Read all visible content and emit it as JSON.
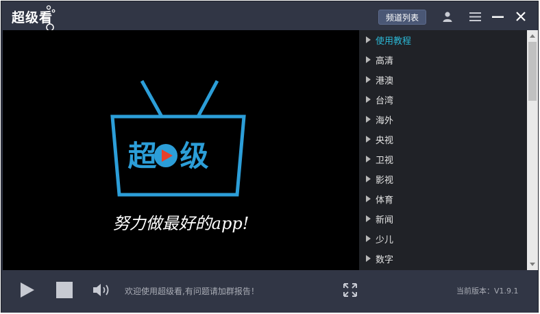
{
  "app": {
    "title": "超级看"
  },
  "titlebar": {
    "channel_list_button": "频道列表",
    "icons": [
      "user-icon",
      "menu-icon",
      "minimize-icon",
      "close-icon"
    ]
  },
  "video": {
    "logo_text": "超级",
    "tagline": "努力做最好的app!"
  },
  "channels": {
    "items": [
      {
        "label": "使用教程",
        "active": true
      },
      {
        "label": "高清",
        "active": false
      },
      {
        "label": "港澳",
        "active": false
      },
      {
        "label": "台湾",
        "active": false
      },
      {
        "label": "海外",
        "active": false
      },
      {
        "label": "央视",
        "active": false
      },
      {
        "label": "卫视",
        "active": false
      },
      {
        "label": "影视",
        "active": false
      },
      {
        "label": "体育",
        "active": false
      },
      {
        "label": "新闻",
        "active": false
      },
      {
        "label": "少儿",
        "active": false
      },
      {
        "label": "数字",
        "active": false
      }
    ]
  },
  "controls": {
    "welcome_text": "欢迎使用超级看,有问题请加群报告！",
    "version_text": "当前版本：V1.9.1",
    "icons": [
      "play-icon",
      "stop-icon",
      "volume-icon",
      "fullscreen-icon"
    ]
  },
  "colors": {
    "frame": "#313645",
    "accent": "#2bb7d5",
    "logo_blue": "#2c9ed8",
    "play_red": "#e8402c",
    "list_bg": "#202227"
  }
}
